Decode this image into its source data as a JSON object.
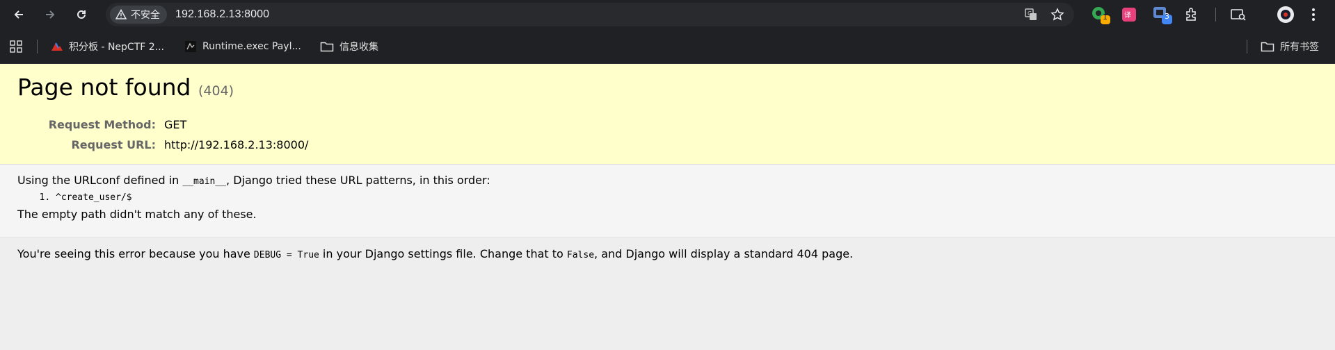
{
  "browser": {
    "security_label": "不安全",
    "url": "192.168.2.13:8000",
    "extension_badges": [
      "1",
      "3"
    ]
  },
  "bookmarks": {
    "items": [
      {
        "label": "积分板 - NepCTF 2...",
        "icon": "nepctf-icon"
      },
      {
        "label": "Runtime.exec Payl...",
        "icon": "runtime-icon"
      },
      {
        "label": "信息收集",
        "icon": "folder-icon"
      }
    ],
    "all_bookmarks": "所有书签"
  },
  "page": {
    "title": "Page not found",
    "status": "(404)",
    "request_method_label": "Request Method:",
    "request_method": "GET",
    "request_url_label": "Request URL:",
    "request_url": "http://192.168.2.13:8000/",
    "urlconf_intro_1": "Using the URLconf defined in ",
    "urlconf_module": "__main__",
    "urlconf_intro_2": ", Django tried these URL patterns, in this order:",
    "patterns": [
      "^create_user/$"
    ],
    "no_match": "The empty path didn't match any of these.",
    "debug_1": "You're seeing this error because you have ",
    "debug_code": "DEBUG = True",
    "debug_2": " in your Django settings file. Change that to ",
    "debug_false": "False",
    "debug_3": ", and Django will display a standard 404 page."
  }
}
